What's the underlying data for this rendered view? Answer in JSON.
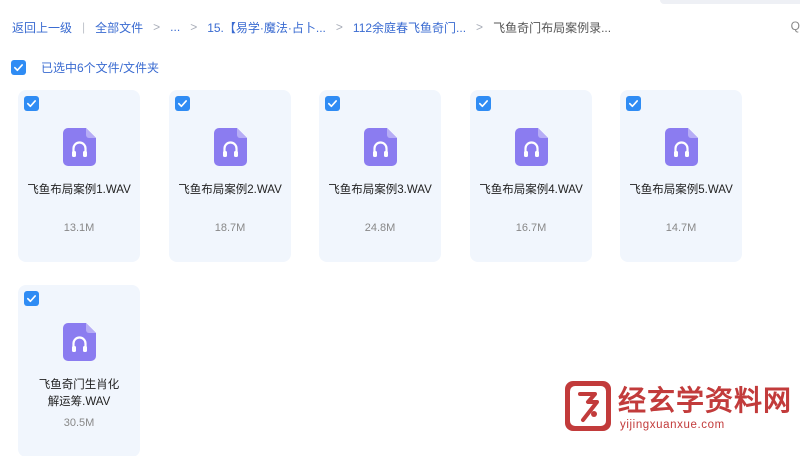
{
  "breadcrumb": {
    "back_label": "返回上一级",
    "items": [
      "全部文件",
      "...",
      "15.【易学·魔法·占卜...",
      "112余庭春飞鱼奇门...",
      "飞鱼奇门布局案例录..."
    ],
    "trailing": "Q"
  },
  "selection": {
    "label": "已选中6个文件/文件夹"
  },
  "files": [
    {
      "name": "飞鱼布局案例1.WAV",
      "size": "13.1M",
      "icon": "audio-file-icon",
      "checked": true
    },
    {
      "name": "飞鱼布局案例2.WAV",
      "size": "18.7M",
      "icon": "audio-file-icon",
      "checked": true
    },
    {
      "name": "飞鱼布局案例3.WAV",
      "size": "24.8M",
      "icon": "audio-file-icon",
      "checked": true
    },
    {
      "name": "飞鱼布局案例4.WAV",
      "size": "16.7M",
      "icon": "audio-file-icon",
      "checked": true
    },
    {
      "name": "飞鱼布局案例5.WAV",
      "size": "14.7M",
      "icon": "audio-file-icon",
      "checked": true
    },
    {
      "name": "飞鱼奇门生肖化解运筹.WAV",
      "size": "30.5M",
      "icon": "audio-file-icon",
      "checked": true
    }
  ],
  "watermark": {
    "title": "经玄学资料网",
    "url": "yijingxuanxue.com"
  },
  "colors": {
    "accent": "#2f8cf4",
    "link": "#3a6bd1",
    "card_bg": "#f1f6fd",
    "icon_purple": "#8b7cf0",
    "watermark_red": "#c23b3b"
  }
}
